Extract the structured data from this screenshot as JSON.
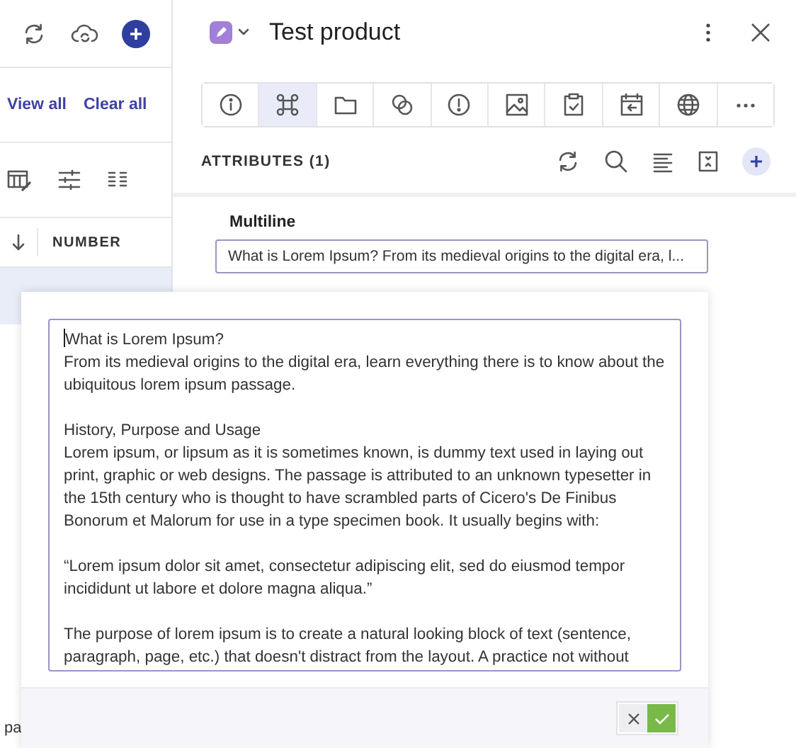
{
  "sidebar": {
    "links": [
      "View all",
      "Clear all"
    ],
    "table": {
      "columns": [
        "NUMBER"
      ]
    },
    "cut_text": "pa"
  },
  "panel": {
    "title": "Test product",
    "tabs": [
      {
        "selected": false
      },
      {
        "selected": true
      },
      {
        "selected": false
      },
      {
        "selected": false
      },
      {
        "selected": false
      },
      {
        "selected": false
      },
      {
        "selected": false
      },
      {
        "selected": false
      },
      {
        "selected": false
      },
      {
        "selected": false
      }
    ],
    "section": {
      "title": "ATTRIBUTES (1)"
    },
    "field": {
      "label": "Multiline",
      "value": "What is Lorem Ipsum? From its medieval origins to the digital era, l..."
    }
  },
  "editor": {
    "paragraphs": [
      [
        "What is Lorem Ipsum?",
        "From its medieval origins to the digital era, learn everything there is to know about the",
        "ubiquitous lorem ipsum passage."
      ],
      [
        "History, Purpose and Usage",
        "Lorem ipsum, or lipsum as it is sometimes known, is dummy text used in laying out",
        "print, graphic or web designs. The passage is attributed to an unknown typesetter in",
        "the 15th century who is thought to have scrambled parts of Cicero's De Finibus",
        "Bonorum et Malorum for use in a type specimen book. It usually begins with:"
      ],
      [
        "“Lorem ipsum dolor sit amet, consectetur adipiscing elit, sed do eiusmod tempor",
        "incididunt ut labore et dolore magna aliqua.”"
      ],
      [
        "The purpose of lorem ipsum is to create a natural looking block of text (sentence,",
        "paragraph, page, etc.) that doesn't distract from the layout. A practice not without"
      ]
    ]
  }
}
